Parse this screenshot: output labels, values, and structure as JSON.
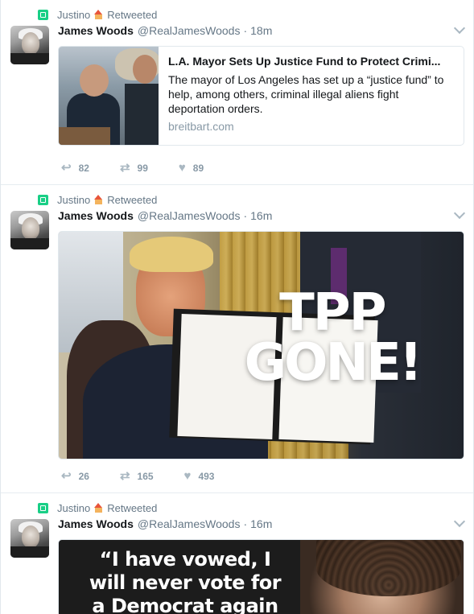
{
  "tweets": [
    {
      "retweeter": "Justino",
      "retweeted_label": "Retweeted",
      "name": "James Woods",
      "handle": "@RealJamesWoods",
      "separator": "·",
      "time": "18m",
      "card": {
        "title": "L.A. Mayor Sets Up Justice Fund to Protect Crimi...",
        "description": "The mayor of Los Angeles has set up a “justice fund” to help, among others, criminal illegal aliens fight deportation orders.",
        "domain": "breitbart.com"
      },
      "replies": "82",
      "retweets": "99",
      "likes": "89"
    },
    {
      "retweeter": "Justino",
      "retweeted_label": "Retweeted",
      "name": "James Woods",
      "handle": "@RealJamesWoods",
      "separator": "·",
      "time": "16m",
      "media_text": {
        "line1": "TPP",
        "line2": "GONE!"
      },
      "replies": "26",
      "retweets": "165",
      "likes": "493"
    },
    {
      "retweeter": "Justino",
      "retweeted_label": "Retweeted",
      "name": "James Woods",
      "handle": "@RealJamesWoods",
      "separator": "·",
      "time": "16m",
      "media_text": {
        "quote": "“I have vowed, I will never vote for a Democrat again"
      }
    }
  ],
  "icons": {
    "retweet_badge": "retweet-badge-icon",
    "house": "house-emoji-icon",
    "caret": "chevron-down-icon",
    "reply": "reply-icon",
    "retweet": "retweet-icon",
    "like": "heart-icon"
  },
  "colors": {
    "retweet_green": "#19cf86",
    "muted_text": "#657786",
    "action_gray": "#aab8c2",
    "border": "#e1e8ed"
  }
}
